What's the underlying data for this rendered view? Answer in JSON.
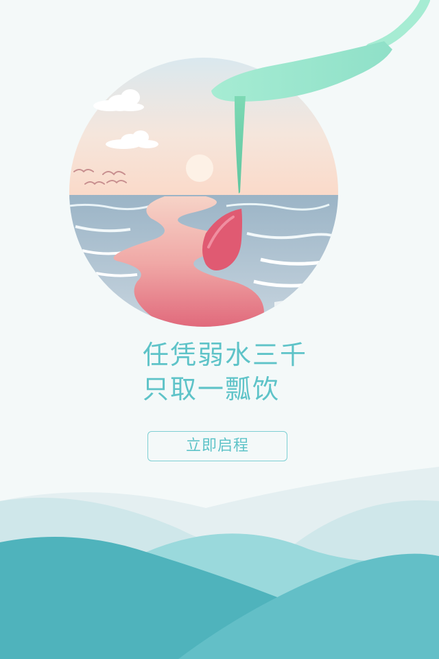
{
  "slogan": {
    "line1": "任凭弱水三千",
    "line2": "只取一瓢饮"
  },
  "start_button": {
    "label": "立即启程"
  },
  "colors": {
    "background": "#f4f9f9",
    "accent_teal": "#5ec3c8",
    "spoon_mint": "#a6ecd3",
    "drop_pink": "#e05a72",
    "hill_dark": "#4fb3bc",
    "hill_light": "#9ad9dc"
  }
}
